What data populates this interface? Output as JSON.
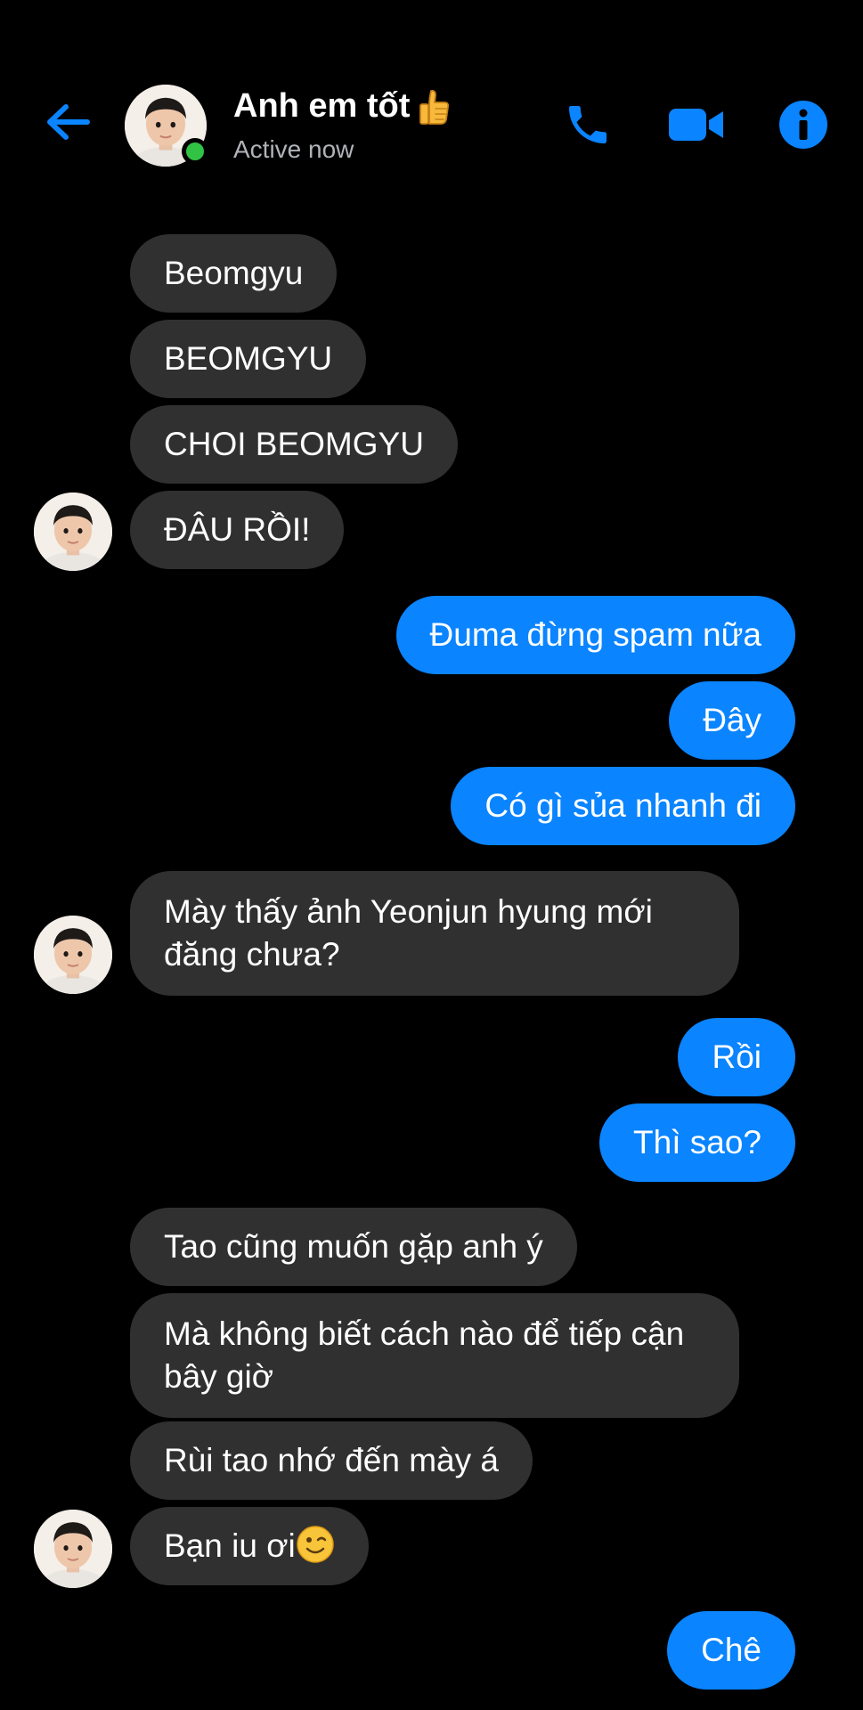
{
  "header": {
    "contact_name": "Anh em tốt",
    "status": "Active now",
    "accent_color": "#0a84ff",
    "online_color": "#31c344",
    "icons": [
      "back-arrow-icon",
      "phone-icon",
      "video-camera-icon",
      "info-icon",
      "thumbs-up-icon"
    ]
  },
  "messages": [
    {
      "direction": "in",
      "text": "Beomgyu"
    },
    {
      "direction": "in",
      "text": "BEOMGYU"
    },
    {
      "direction": "in",
      "text": "CHOI BEOMGYU"
    },
    {
      "direction": "in",
      "text": "ĐÂU RỒI!"
    },
    {
      "direction": "out",
      "text": "Đuma đừng spam nữa"
    },
    {
      "direction": "out",
      "text": "Đây"
    },
    {
      "direction": "out",
      "text": "Có gì sủa nhanh đi"
    },
    {
      "direction": "in",
      "text": "Mày thấy ảnh Yeonjun hyung mới đăng chưa?"
    },
    {
      "direction": "out",
      "text": "Rồi"
    },
    {
      "direction": "out",
      "text": "Thì sao?"
    },
    {
      "direction": "in",
      "text": "Tao cũng muốn gặp anh ý"
    },
    {
      "direction": "in",
      "text": "Mà không biết cách nào để tiếp cận bây giờ"
    },
    {
      "direction": "in",
      "text": "Rùi tao nhớ đến mày á"
    },
    {
      "direction": "in",
      "text": "Bạn iu ơi",
      "emoji": "winking-face-icon"
    },
    {
      "direction": "out",
      "text": "Chê"
    }
  ],
  "colors": {
    "incoming_bubble": "#303030",
    "outgoing_bubble": "#0a84ff",
    "background": "#000000"
  }
}
